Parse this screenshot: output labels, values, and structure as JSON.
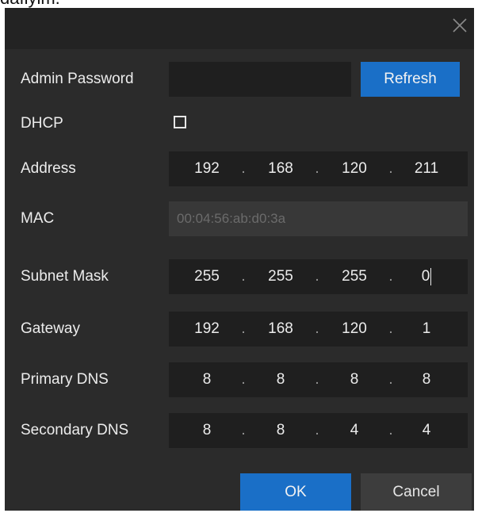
{
  "top_caption": "dafiyim.",
  "dialog": {
    "close_icon": "close-icon",
    "admin_password": {
      "label": "Admin Password",
      "value": "",
      "refresh_label": "Refresh"
    },
    "dhcp": {
      "label": "DHCP",
      "checked": false
    },
    "address": {
      "label": "Address",
      "octets": [
        "192",
        "168",
        "120",
        "211"
      ]
    },
    "mac": {
      "label": "MAC",
      "value": "00:04:56:ab:d0:3a"
    },
    "subnet_mask": {
      "label": "Subnet Mask",
      "octets": [
        "255",
        "255",
        "255",
        "0"
      ]
    },
    "gateway": {
      "label": "Gateway",
      "octets": [
        "192",
        "168",
        "120",
        "1"
      ]
    },
    "primary_dns": {
      "label": "Primary DNS",
      "octets": [
        "8",
        "8",
        "8",
        "8"
      ]
    },
    "secondary_dns": {
      "label": "Secondary DNS",
      "octets": [
        "8",
        "8",
        "4",
        "4"
      ]
    },
    "ok_label": "OK",
    "cancel_label": "Cancel"
  },
  "colors": {
    "dialog_bg": "#2b2b2b",
    "titlebar_bg": "#232323",
    "field_bg": "#1f1f1f",
    "disabled_field_bg": "#383838",
    "accent": "#1a6fc7",
    "secondary_button": "#3d3d3d",
    "text": "#ececec",
    "disabled_text": "#6b6b6b"
  }
}
